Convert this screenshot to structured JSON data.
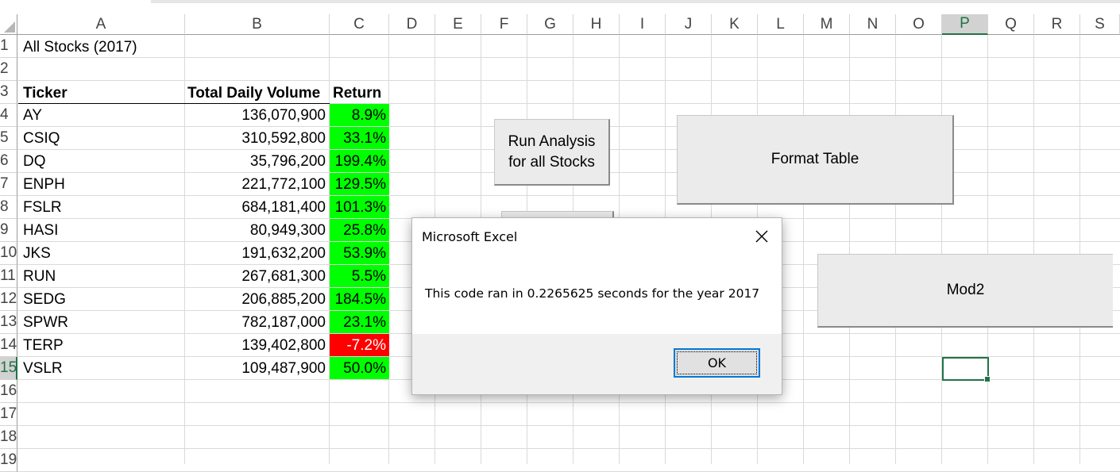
{
  "columns": [
    "A",
    "B",
    "C",
    "D",
    "E",
    "F",
    "G",
    "H",
    "I",
    "J",
    "K",
    "L",
    "M",
    "N",
    "O",
    "P",
    "Q",
    "R",
    "S"
  ],
  "selected_column": "P",
  "rows": [
    "1",
    "2",
    "3",
    "4",
    "5",
    "6",
    "7",
    "8",
    "9",
    "10",
    "11",
    "12",
    "13",
    "14",
    "15",
    "16",
    "17",
    "18",
    "19"
  ],
  "selected_row": "15",
  "sheet": {
    "a1_title": "All Stocks (2017)",
    "headers": {
      "ticker": "Ticker",
      "volume": "Total Daily Volume",
      "return": "Return"
    },
    "data": [
      {
        "ticker": "AY",
        "volume": "136,070,900",
        "return": "8.9%",
        "color": "#00ff00"
      },
      {
        "ticker": "CSIQ",
        "volume": "310,592,800",
        "return": "33.1%",
        "color": "#00ff00"
      },
      {
        "ticker": "DQ",
        "volume": "35,796,200",
        "return": "199.4%",
        "color": "#00ff00"
      },
      {
        "ticker": "ENPH",
        "volume": "221,772,100",
        "return": "129.5%",
        "color": "#00ff00"
      },
      {
        "ticker": "FSLR",
        "volume": "684,181,400",
        "return": "101.3%",
        "color": "#00ff00"
      },
      {
        "ticker": "HASI",
        "volume": "80,949,300",
        "return": "25.8%",
        "color": "#00ff00"
      },
      {
        "ticker": "JKS",
        "volume": "191,632,200",
        "return": "53.9%",
        "color": "#00ff00"
      },
      {
        "ticker": "RUN",
        "volume": "267,681,300",
        "return": "5.5%",
        "color": "#00ff00"
      },
      {
        "ticker": "SEDG",
        "volume": "206,885,200",
        "return": "184.5%",
        "color": "#00ff00"
      },
      {
        "ticker": "SPWR",
        "volume": "782,187,000",
        "return": "23.1%",
        "color": "#00ff00"
      },
      {
        "ticker": "TERP",
        "volume": "139,402,800",
        "return": "-7.2%",
        "color": "#ff0000"
      },
      {
        "ticker": "VSLR",
        "volume": "109,487,900",
        "return": "50.0%",
        "color": "#00ff00"
      }
    ]
  },
  "buttons": {
    "run_analysis_line1": "Run Analysis",
    "run_analysis_line2": "for all Stocks",
    "format_table": "Format Table",
    "mod2": "Mod2"
  },
  "dialog": {
    "title": "Microsoft Excel",
    "message": "This code ran in 0.2265625 seconds for the year 2017",
    "ok_label": "OK",
    "close_icon": "close-icon"
  }
}
